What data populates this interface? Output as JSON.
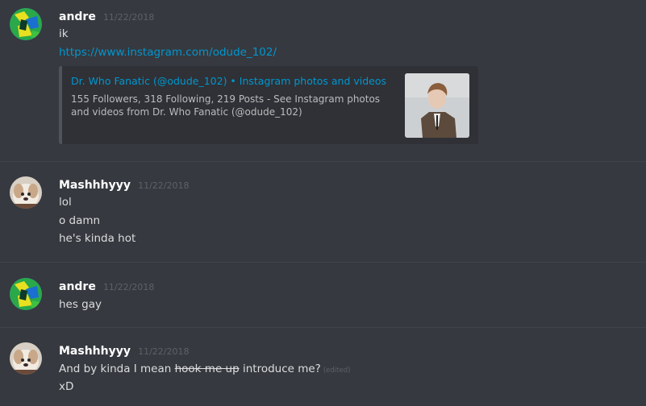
{
  "messages": [
    {
      "username": "andre",
      "timestamp": "11/22/2018",
      "lines": [
        "ik"
      ],
      "link": "https://www.instagram.com/odude_102/",
      "embed": {
        "title": "Dr. Who Fanatic (@odude_102) • Instagram photos and videos",
        "description": "155 Followers, 318 Following, 219 Posts - See Instagram photos and videos from Dr. Who Fanatic (@odude_102)"
      }
    },
    {
      "username": "Mashhhyyy",
      "timestamp": "11/22/2018",
      "lines": [
        "lol",
        "o damn",
        "he's kinda hot"
      ]
    },
    {
      "username": "andre",
      "timestamp": "11/22/2018",
      "lines": [
        "hes gay"
      ]
    },
    {
      "username": "Mashhhyyy",
      "timestamp": "11/22/2018",
      "line1": {
        "before": "And by kinda I mean ",
        "struck": "hook me up",
        "after": " introduce me?",
        "edited": "(edited)"
      },
      "line2": "xD"
    }
  ],
  "theme": {
    "background": "#36393f",
    "link_color": "#0096cf",
    "embed_bg": "#2f3136"
  }
}
